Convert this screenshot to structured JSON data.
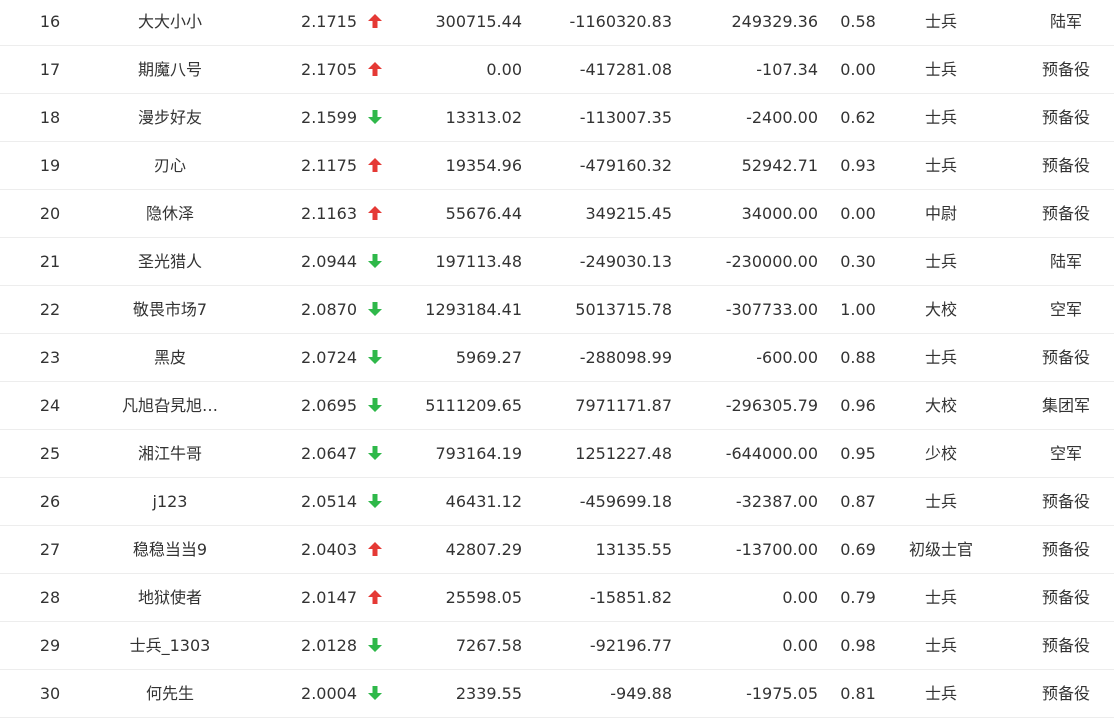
{
  "colors": {
    "up": "#e53935",
    "down": "#2fb84a",
    "text": "#333333",
    "divider": "#ededed"
  },
  "rows": [
    {
      "rank": "16",
      "name": "大大小小",
      "score": "2.1715",
      "trend": "up",
      "v1": "300715.44",
      "v2": "-1160320.83",
      "v3": "249329.36",
      "ratio": "0.58",
      "title": "士兵",
      "branch": "陆军"
    },
    {
      "rank": "17",
      "name": "期魔八号",
      "score": "2.1705",
      "trend": "up",
      "v1": "0.00",
      "v2": "-417281.08",
      "v3": "-107.34",
      "ratio": "0.00",
      "title": "士兵",
      "branch": "预备役"
    },
    {
      "rank": "18",
      "name": "漫步好友",
      "score": "2.1599",
      "trend": "down",
      "v1": "13313.02",
      "v2": "-113007.35",
      "v3": "-2400.00",
      "ratio": "0.62",
      "title": "士兵",
      "branch": "预备役"
    },
    {
      "rank": "19",
      "name": "刃心",
      "score": "2.1175",
      "trend": "up",
      "v1": "19354.96",
      "v2": "-479160.32",
      "v3": "52942.71",
      "ratio": "0.93",
      "title": "士兵",
      "branch": "预备役"
    },
    {
      "rank": "20",
      "name": "隐休泽",
      "score": "2.1163",
      "trend": "up",
      "v1": "55676.44",
      "v2": "349215.45",
      "v3": "34000.00",
      "ratio": "0.00",
      "title": "中尉",
      "branch": "预备役"
    },
    {
      "rank": "21",
      "name": "圣光猎人",
      "score": "2.0944",
      "trend": "down",
      "v1": "197113.48",
      "v2": "-249030.13",
      "v3": "-230000.00",
      "ratio": "0.30",
      "title": "士兵",
      "branch": "陆军"
    },
    {
      "rank": "22",
      "name": "敬畏市场7",
      "score": "2.0870",
      "trend": "down",
      "v1": "1293184.41",
      "v2": "5013715.78",
      "v3": "-307733.00",
      "ratio": "1.00",
      "title": "大校",
      "branch": "空军"
    },
    {
      "rank": "23",
      "name": "黑皮",
      "score": "2.0724",
      "trend": "down",
      "v1": "5969.27",
      "v2": "-288098.99",
      "v3": "-600.00",
      "ratio": "0.88",
      "title": "士兵",
      "branch": "预备役"
    },
    {
      "rank": "24",
      "name": "凡旭旮旯旭…",
      "score": "2.0695",
      "trend": "down",
      "v1": "5111209.65",
      "v2": "7971171.87",
      "v3": "-296305.79",
      "ratio": "0.96",
      "title": "大校",
      "branch": "集团军"
    },
    {
      "rank": "25",
      "name": "湘江牛哥",
      "score": "2.0647",
      "trend": "down",
      "v1": "793164.19",
      "v2": "1251227.48",
      "v3": "-644000.00",
      "ratio": "0.95",
      "title": "少校",
      "branch": "空军"
    },
    {
      "rank": "26",
      "name": "j123",
      "score": "2.0514",
      "trend": "down",
      "v1": "46431.12",
      "v2": "-459699.18",
      "v3": "-32387.00",
      "ratio": "0.87",
      "title": "士兵",
      "branch": "预备役"
    },
    {
      "rank": "27",
      "name": "稳稳当当9",
      "score": "2.0403",
      "trend": "up",
      "v1": "42807.29",
      "v2": "13135.55",
      "v3": "-13700.00",
      "ratio": "0.69",
      "title": "初级士官",
      "branch": "预备役"
    },
    {
      "rank": "28",
      "name": "地狱使者",
      "score": "2.0147",
      "trend": "up",
      "v1": "25598.05",
      "v2": "-15851.82",
      "v3": "0.00",
      "ratio": "0.79",
      "title": "士兵",
      "branch": "预备役"
    },
    {
      "rank": "29",
      "name": "士兵_1303",
      "score": "2.0128",
      "trend": "down",
      "v1": "7267.58",
      "v2": "-92196.77",
      "v3": "0.00",
      "ratio": "0.98",
      "title": "士兵",
      "branch": "预备役"
    },
    {
      "rank": "30",
      "name": "何先生",
      "score": "2.0004",
      "trend": "down",
      "v1": "2339.55",
      "v2": "-949.88",
      "v3": "-1975.05",
      "ratio": "0.81",
      "title": "士兵",
      "branch": "预备役"
    }
  ]
}
